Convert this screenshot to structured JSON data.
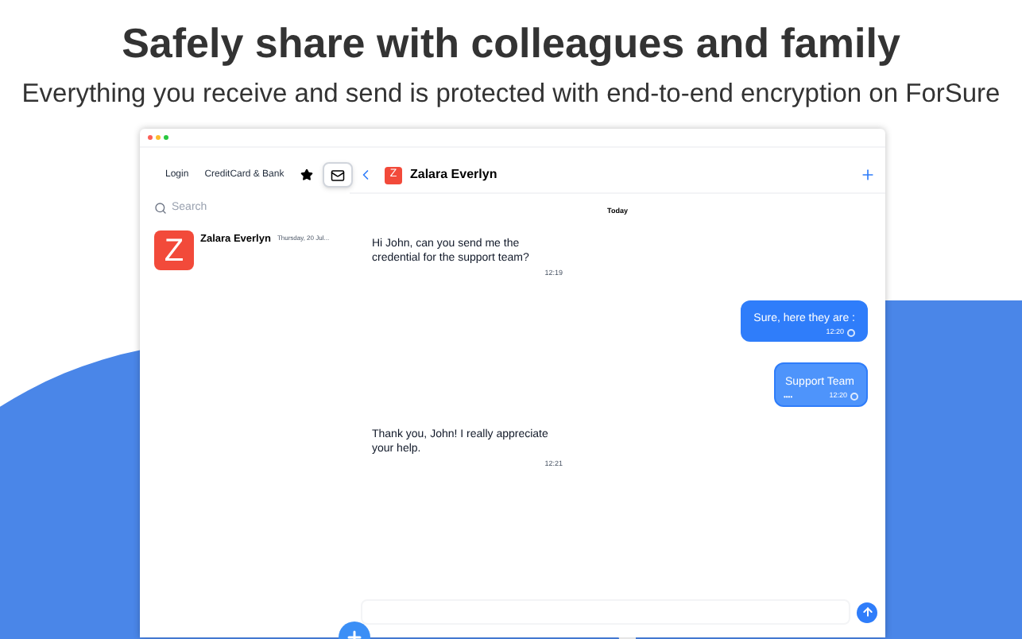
{
  "headline": "Safely share with colleagues and family",
  "subheadline": "Everything you receive and send is protected with end-to-end encryption on ForSure",
  "sidebar": {
    "tabs": [
      {
        "kind": "text",
        "label": "Login",
        "selected": false
      },
      {
        "kind": "text",
        "label": "CreditCard & Bank",
        "selected": false
      },
      {
        "kind": "star",
        "selected": false
      },
      {
        "kind": "mail",
        "selected": true
      }
    ],
    "search": {
      "placeholder": "Search"
    },
    "conversations": [
      {
        "initial": "Z",
        "name": "Zalara Everlyn",
        "date": "Thursday, 20 Jul...",
        "selected": false
      }
    ]
  },
  "chat": {
    "initial": "Z",
    "name": "Zalara Everlyn",
    "day": "Today",
    "messages": [
      {
        "kind": "incoming",
        "text": "Hi John, can you send me the credential for the support team?",
        "time": "12:19"
      },
      {
        "kind": "outgoing",
        "text": "Sure, here they are :",
        "time": "12:20"
      },
      {
        "kind": "credential",
        "text": "Support Team",
        "masked": "••••",
        "time": "12:20"
      },
      {
        "kind": "incoming",
        "text": "Thank you, John! I really appreciate your help.",
        "time": "12:21"
      }
    ]
  }
}
